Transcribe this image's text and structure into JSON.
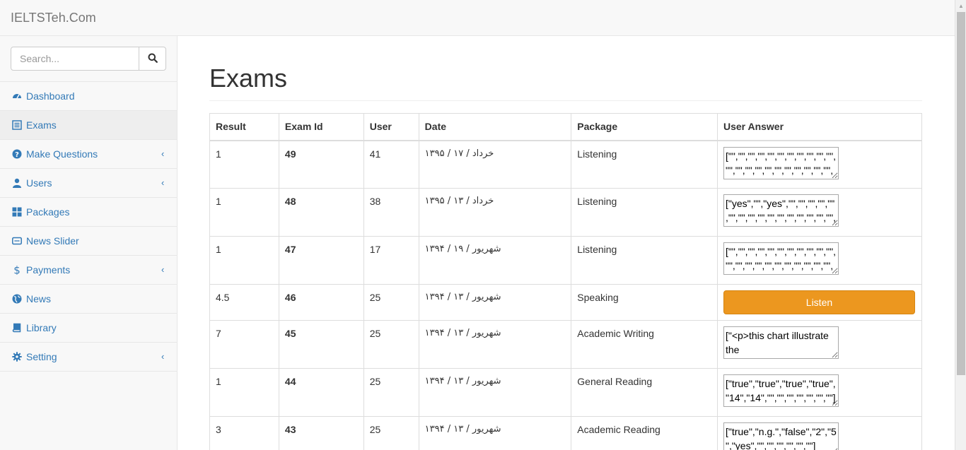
{
  "navbar": {
    "brand": "IELTSTeh.Com"
  },
  "search": {
    "placeholder": "Search..."
  },
  "sidebar": {
    "items": [
      {
        "label": "Dashboard",
        "icon": "dashboard-icon",
        "active": false,
        "submenu": false
      },
      {
        "label": "Exams",
        "icon": "list-icon",
        "active": true,
        "submenu": false
      },
      {
        "label": "Make Questions",
        "icon": "question-circle-icon",
        "active": false,
        "submenu": true
      },
      {
        "label": "Users",
        "icon": "user-icon",
        "active": false,
        "submenu": true
      },
      {
        "label": "Packages",
        "icon": "grid-icon",
        "active": false,
        "submenu": false
      },
      {
        "label": "News Slider",
        "icon": "slider-icon",
        "active": false,
        "submenu": false
      },
      {
        "label": "Payments",
        "icon": "dollar-icon",
        "active": false,
        "submenu": true
      },
      {
        "label": "News",
        "icon": "globe-icon",
        "active": false,
        "submenu": false
      },
      {
        "label": "Library",
        "icon": "book-icon",
        "active": false,
        "submenu": false
      },
      {
        "label": "Setting",
        "icon": "cog-icon",
        "active": false,
        "submenu": true
      }
    ]
  },
  "page": {
    "title": "Exams"
  },
  "table": {
    "headers": [
      "Result",
      "Exam Id",
      "User",
      "Date",
      "Package",
      "User Answer"
    ],
    "rows": [
      {
        "result": "1",
        "exam_id": "49",
        "user": "41",
        "date": "خرداد / ۱۷ / ۱۳۹۵",
        "package": "Listening",
        "answer": "[\"\",\"\",\"\",\"\",\"\",\"\",\"\",\"\",\"\",\"\",\"\",\"\",\"\",\"\",\"\",\"\",\"\",\"\",\"\",\"\",\"\",\"\",\"\",\"\",\"\",\"\",\"\",\"\",\"\",\"\",\"\",\"\",\"\",\"\",\"\",\"\",\"\",\"\",\"\",\"\"]",
        "listen": false
      },
      {
        "result": "1",
        "exam_id": "48",
        "user": "38",
        "date": "خرداد / ۱۳ / ۱۳۹۵",
        "package": "Listening",
        "answer": "[\"yes\",\"\",\"yes\",\"\",\"\",\"\",\"\",\"\",\"\",\"\",\"\",\"\",\"\",\"\",\"\",\"\",\"\",\"\",\"\",\"\",\"\",\"\",\"\",\"\",\"\",\"\",\"\",\"\",\"\",\"\",\"\",\"\",\"\",\"\",\"\",\"\",\"\",\"\",\"\",\"\"]",
        "listen": false
      },
      {
        "result": "1",
        "exam_id": "47",
        "user": "17",
        "date": "شهریور / ۱۹ / ۱۳۹۴",
        "package": "Listening",
        "answer": "[\"\",\"\",\"\",\"\",\"\",\"\",\"\",\"\",\"\",\"\",\"\",\"\",\"\",\"\",\"\",\"\",\"\",\"\",\"\",\"\",\"\",\"\",\"\",\"\",\"\",\"\",\"\",\"\",\"\",\"\",\"\",\"\",\"\",\"\",\"\",\"\",\"\",\"\",\"\",\"\"]",
        "listen": false
      },
      {
        "result": "4.5",
        "exam_id": "46",
        "user": "25",
        "date": "شهریور / ۱۳ / ۱۳۹۴",
        "package": "Speaking",
        "answer": "Listen",
        "listen": true
      },
      {
        "result": "7",
        "exam_id": "45",
        "user": "25",
        "date": "شهریور / ۱۳ / ۱۳۹۴",
        "package": "Academic Writing",
        "answer": "[\"<p>this chart illustrate the",
        "listen": false
      },
      {
        "result": "1",
        "exam_id": "44",
        "user": "25",
        "date": "شهریور / ۱۳ / ۱۳۹۴",
        "package": "General Reading",
        "answer": "[\"true\",\"true\",\"true\",\"true\",\"14\",\"14\",\"\",\"\",\"\",\"\",\"\",\"\",\"\"]",
        "listen": false
      },
      {
        "result": "3",
        "exam_id": "43",
        "user": "25",
        "date": "شهریور / ۱۳ / ۱۳۹۴",
        "package": "Academic Reading",
        "answer": "[\"true\",\"n.g.\",\"false\",\"2\",\"5\",\"yes\",\"\",\"\",\"\",\"\",\"\",\"\"]",
        "listen": false
      }
    ]
  },
  "colors": {
    "link": "#337ab7",
    "warning_button": "#ec971f"
  }
}
